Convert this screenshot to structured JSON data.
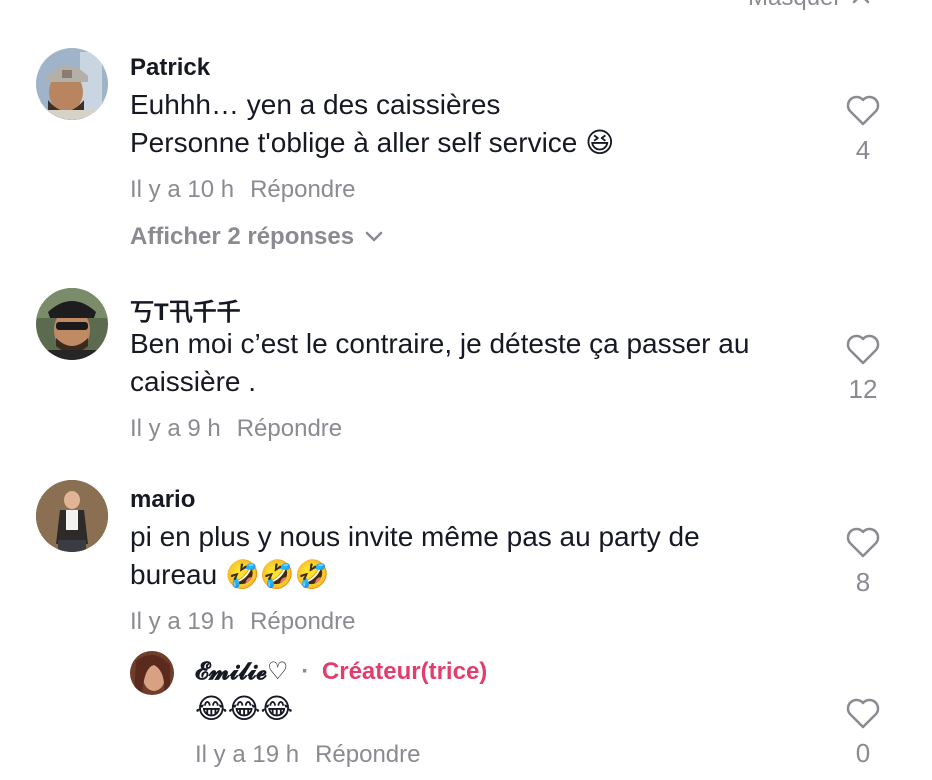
{
  "header": {
    "hide_label": "Masquer"
  },
  "comments": [
    {
      "username": "Patrick",
      "line1": "Euhhh… yen a des caissières",
      "line2": "Personne t'oblige à aller self service 😆",
      "time": "Il y a 10 h",
      "reply": "Répondre",
      "likes": "4",
      "view_replies": "Afficher 2 réponses"
    },
    {
      "username": "丂T卂千千",
      "line1": "Ben moi c’est le contraire, je déteste ça passer au",
      "line2": "caissière .",
      "time": "Il y a 9 h",
      "reply": "Répondre",
      "likes": "12"
    },
    {
      "username": "mario",
      "line1": "pi en plus y nous invite même pas au party de",
      "line2": "bureau 🤣🤣🤣",
      "time": "Il y a 19 h",
      "reply": "Répondre",
      "likes": "8"
    }
  ],
  "reply_comment": {
    "username": "𝓔𝓶𝓲𝓵𝓲𝓮♡",
    "separator": "·",
    "creator_tag": "Créateur(trice)",
    "text": "😂😂😂",
    "time": "Il y a 19 h",
    "reply": "Répondre",
    "likes": "0"
  }
}
